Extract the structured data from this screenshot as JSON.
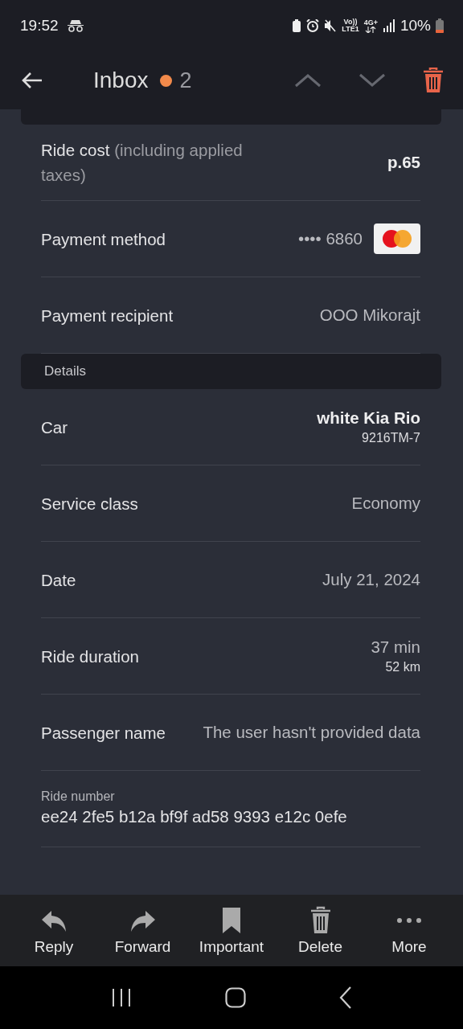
{
  "status_bar": {
    "time": "19:52",
    "volte": "Vo))",
    "lte": "LTE1",
    "network": "4G+",
    "battery": "10%"
  },
  "header": {
    "title": "Inbox",
    "unread_count": "2"
  },
  "sections": [
    {
      "rows": [
        {
          "kind": "plain",
          "label": "Ride cost",
          "label_note": "(including applied taxes)",
          "value": "p.65",
          "bold": true
        },
        {
          "kind": "card",
          "label": "Payment method",
          "value": "•••• 6860"
        },
        {
          "kind": "plain",
          "label": "Payment recipient",
          "value": "OOO Mikorajt",
          "bold": false
        }
      ]
    },
    {
      "title": "Details",
      "rows": [
        {
          "kind": "sub",
          "label": "Car",
          "value": "white Kia Rio",
          "sub": "9216TM-7",
          "bold": true
        },
        {
          "kind": "plain",
          "label": "Service class",
          "value": "Economy",
          "bold": false
        },
        {
          "kind": "plain",
          "label": "Date",
          "value": "July 21, 2024",
          "bold": false
        },
        {
          "kind": "sub",
          "label": "Ride duration",
          "value": "37 min",
          "sub": "52 km",
          "bold": false
        },
        {
          "kind": "plain",
          "label": "Passenger name",
          "value": "The user hasn't provided data",
          "bold": false
        },
        {
          "kind": "stacked",
          "label": "Ride number",
          "value": "ee24 2fe5 b12a bf9f ad58 9393 e12c 0efe"
        }
      ]
    }
  ],
  "toolbar": [
    {
      "kind": "reply",
      "label": "Reply"
    },
    {
      "kind": "forward",
      "label": "Forward"
    },
    {
      "kind": "important",
      "label": "Important"
    },
    {
      "kind": "delete",
      "label": "Delete"
    },
    {
      "kind": "more",
      "label": "More"
    }
  ]
}
